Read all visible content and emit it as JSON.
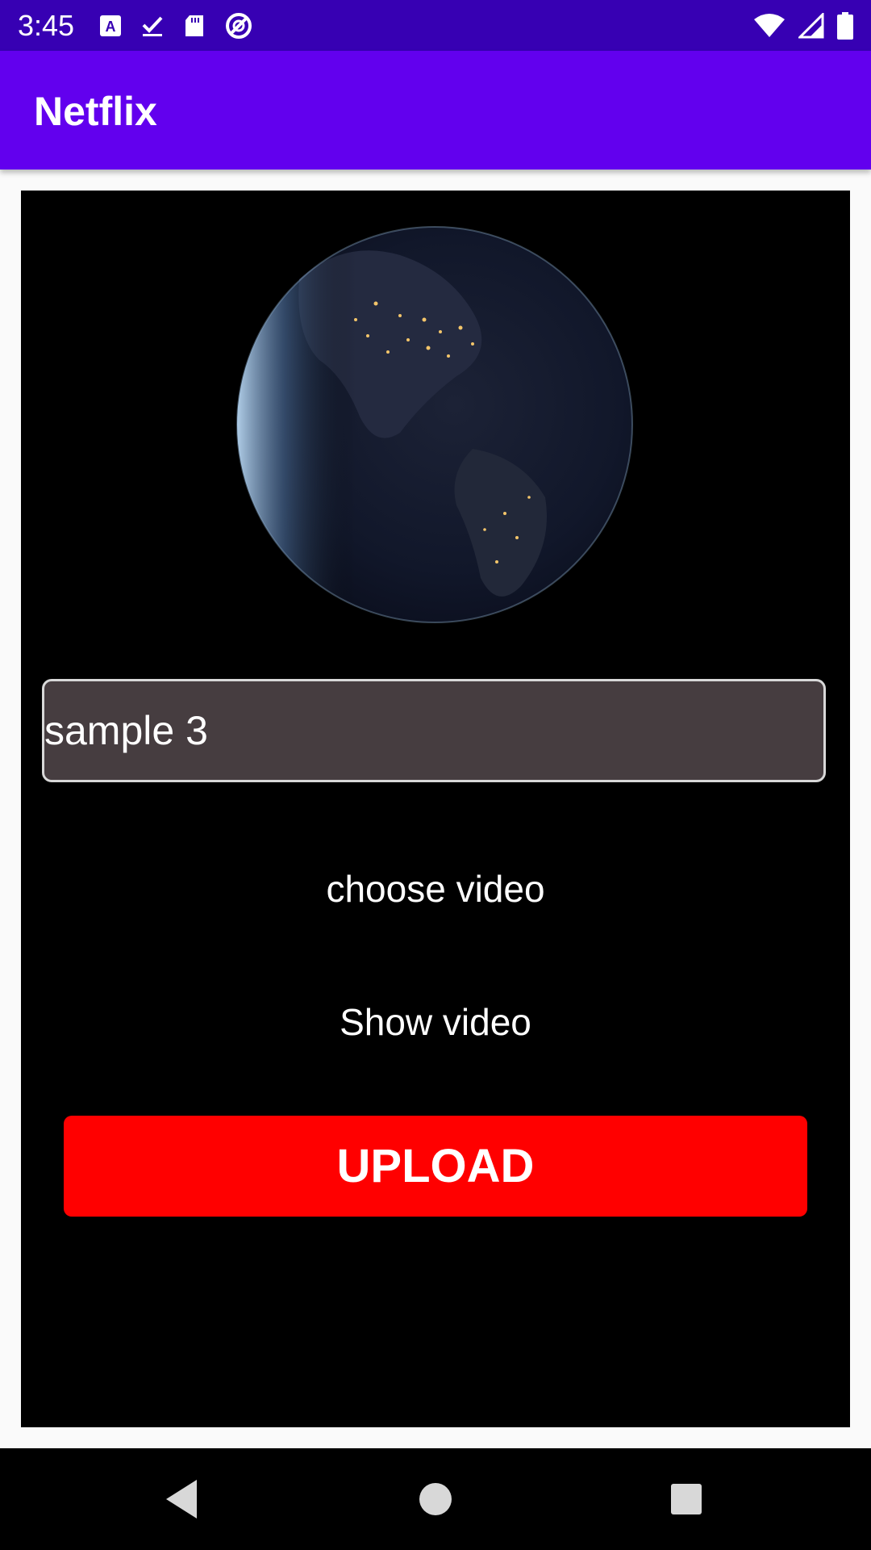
{
  "status_bar": {
    "time": "3:45",
    "left_icons": [
      "keyboard-a-icon",
      "checkmark-download-icon",
      "sd-card-icon",
      "no-disturb-icon"
    ],
    "right_icons": [
      "wifi-icon",
      "cell-signal-icon",
      "battery-icon"
    ],
    "background": "#3700b3"
  },
  "app_bar": {
    "title": "Netflix",
    "background": "#6200ee"
  },
  "main": {
    "video_name_value": "sample 3",
    "choose_video_label": "choose video",
    "show_video_label": "Show video",
    "upload_label": "UPLOAD",
    "upload_color": "#ff0000",
    "panel_background": "#000000"
  },
  "nav_bar": {
    "buttons": [
      "back-icon",
      "home-icon",
      "recents-icon"
    ]
  }
}
